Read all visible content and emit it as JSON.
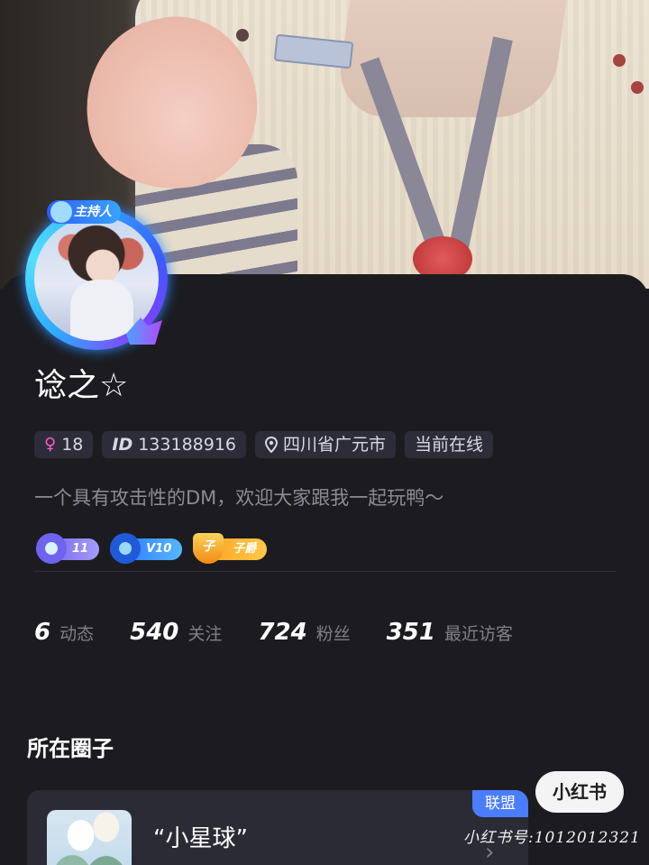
{
  "profile": {
    "host_tag": "主持人",
    "nickname": "谂之☆",
    "tags": {
      "gender_age": "18",
      "id_prefix": "ID",
      "id": "133188916",
      "location": "四川省广元市",
      "online_status": "当前在线"
    },
    "bio": "一个具有攻击性的DM，欢迎大家跟我一起玩鸭～",
    "badges": [
      {
        "label": "11",
        "color": "#7a6cf0"
      },
      {
        "label": "V10",
        "color": "#2f80ff"
      },
      {
        "label": "子爵",
        "emblem_char": "子",
        "color": "#ffa92a"
      }
    ]
  },
  "stats": [
    {
      "num": "6",
      "label": "动态"
    },
    {
      "num": "540",
      "label": "关注"
    },
    {
      "num": "724",
      "label": "粉丝"
    },
    {
      "num": "351",
      "label": "最近访客"
    }
  ],
  "circles": {
    "title": "所在圈子",
    "items": [
      {
        "name": "“小星球”",
        "badge": "联盟"
      }
    ]
  },
  "watermark": {
    "logo": "小红书",
    "text": "小红书号:1012012321"
  },
  "colors": {
    "background": "#1c1c20",
    "tag_bg": "#2d2d3a",
    "accent_blue": "#4a7dff",
    "gender_pink": "#ff5cc0"
  }
}
